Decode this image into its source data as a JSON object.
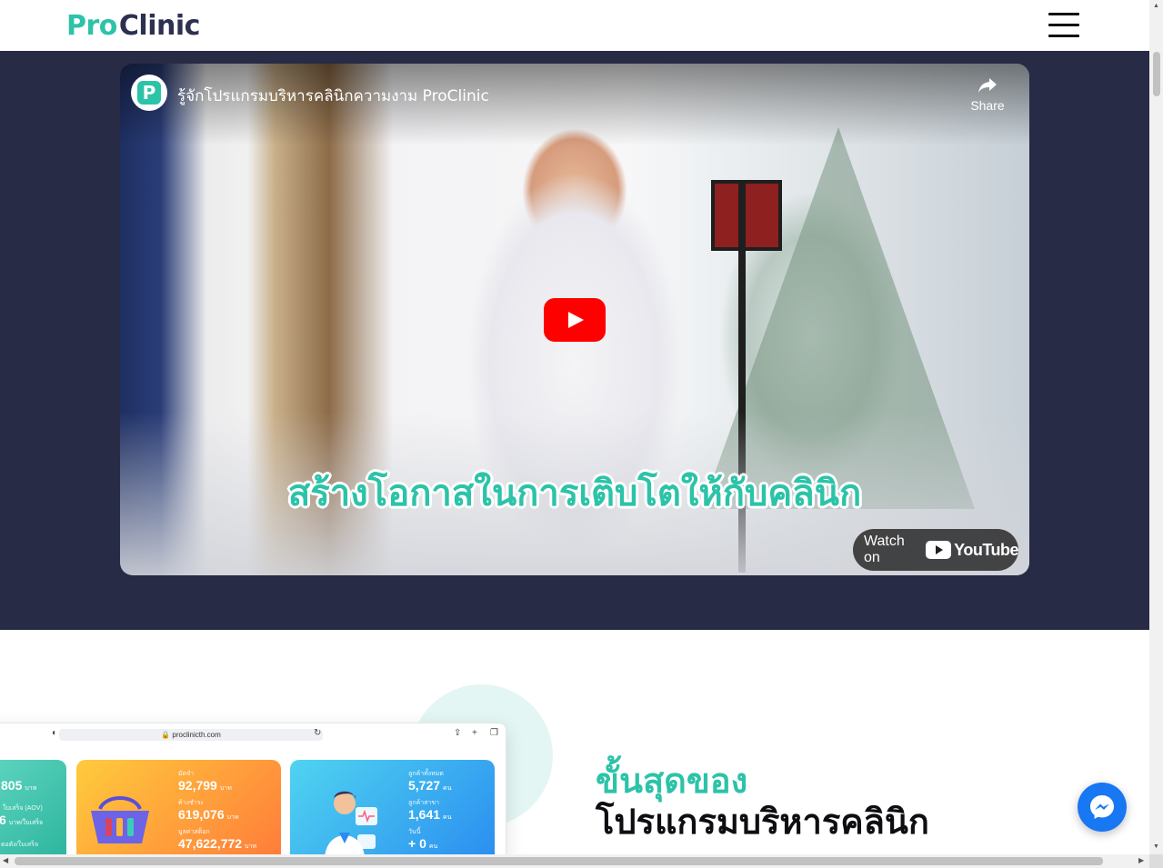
{
  "header": {
    "logo_pro": "Pro",
    "logo_clinic": "Clinic",
    "menu_icon": "hamburger-menu-icon"
  },
  "video": {
    "title": "รู้จักโปรแกรมบริหารคลินิกความงาม ProClinic",
    "share_label": "Share",
    "caption": "สร้างโอกาสในการเติบโตให้กับคลินิก",
    "watch_on_label": "Watch on",
    "youtube_label": "YouTube",
    "channel_avatar_letter": "P"
  },
  "mockup": {
    "url": "proclinicth.com",
    "green_card": {
      "value1": "805",
      "unit1": "บาท",
      "label1": "ใบเสร็จ (AOV)",
      "value2": "6",
      "unit2": "บาท/ใบเสร็จ",
      "label3": "ตอดัง/ใบเสร็จ"
    },
    "orange_card": {
      "label1": "มัดจำ",
      "value1": "92,799",
      "unit1": "บาท",
      "label2": "ค้างชำระ",
      "value2": "619,076",
      "unit2": "บาท",
      "label3": "มูลค่าสต็อก",
      "value3": "47,622,772",
      "unit3": "บาท"
    },
    "blue_card": {
      "label1": "ลูกค้าทั้งหมด",
      "value1": "5,727",
      "unit1": "คน",
      "label2": "ลูกค้าสาขา",
      "value2": "1,641",
      "unit2": "คน",
      "label3": "วันนี้",
      "value3": "+ 0",
      "unit3": "คน"
    }
  },
  "feature": {
    "heading_green": "ขั้นสุดของ",
    "heading_dark": "โปรแกรมบริหารคลินิก"
  },
  "colors": {
    "brand_green": "#2cc3a8",
    "brand_navy": "#272b45",
    "youtube_red": "#ff0000",
    "messenger_blue": "#1877f2"
  }
}
